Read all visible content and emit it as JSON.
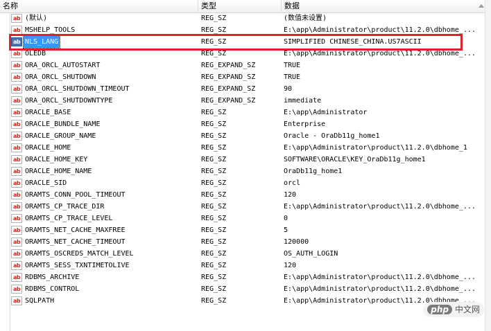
{
  "columns": {
    "name": "名称",
    "type": "类型",
    "data": "数据"
  },
  "value_icon": "ab",
  "rows": [
    {
      "name": "(默认)",
      "type": "REG_SZ",
      "data": "(数值未设置)"
    },
    {
      "name": "MSHELP_TOOLS",
      "type": "REG_SZ",
      "data": "E:\\app\\Administrator\\product\\11.2.0\\dbhome_..."
    },
    {
      "name": "NLS_LANG",
      "type": "REG_SZ",
      "data": "SIMPLIFIED CHINESE_CHINA.US7ASCII"
    },
    {
      "name": "OLEDB",
      "type": "REG_SZ",
      "data": "E:\\app\\Administrator\\product\\11.2.0\\dbhome_..."
    },
    {
      "name": "ORA_ORCL_AUTOSTART",
      "type": "REG_EXPAND_SZ",
      "data": "TRUE"
    },
    {
      "name": "ORA_ORCL_SHUTDOWN",
      "type": "REG_EXPAND_SZ",
      "data": "TRUE"
    },
    {
      "name": "ORA_ORCL_SHUTDOWN_TIMEOUT",
      "type": "REG_EXPAND_SZ",
      "data": "90"
    },
    {
      "name": "ORA_ORCL_SHUTDOWNTYPE",
      "type": "REG_EXPAND_SZ",
      "data": "immediate"
    },
    {
      "name": "ORACLE_BASE",
      "type": "REG_SZ",
      "data": "E:\\app\\Administrator"
    },
    {
      "name": "ORACLE_BUNDLE_NAME",
      "type": "REG_SZ",
      "data": "Enterprise"
    },
    {
      "name": "ORACLE_GROUP_NAME",
      "type": "REG_SZ",
      "data": "Oracle - OraDb11g_home1"
    },
    {
      "name": "ORACLE_HOME",
      "type": "REG_SZ",
      "data": "E:\\app\\Administrator\\product\\11.2.0\\dbhome_1"
    },
    {
      "name": "ORACLE_HOME_KEY",
      "type": "REG_SZ",
      "data": "SOFTWARE\\ORACLE\\KEY_OraDb11g_home1"
    },
    {
      "name": "ORACLE_HOME_NAME",
      "type": "REG_SZ",
      "data": "OraDb11g_home1"
    },
    {
      "name": "ORACLE_SID",
      "type": "REG_SZ",
      "data": "orcl"
    },
    {
      "name": "ORAMTS_CONN_POOL_TIMEOUT",
      "type": "REG_SZ",
      "data": "120"
    },
    {
      "name": "ORAMTS_CP_TRACE_DIR",
      "type": "REG_SZ",
      "data": "E:\\app\\Administrator\\product\\11.2.0\\dbhome_..."
    },
    {
      "name": "ORAMTS_CP_TRACE_LEVEL",
      "type": "REG_SZ",
      "data": "0"
    },
    {
      "name": "ORAMTS_NET_CACHE_MAXFREE",
      "type": "REG_SZ",
      "data": "5"
    },
    {
      "name": "ORAMTS_NET_CACHE_TIMEOUT",
      "type": "REG_SZ",
      "data": "120000"
    },
    {
      "name": "ORAMTS_OSCREDS_MATCH_LEVEL",
      "type": "REG_SZ",
      "data": "OS_AUTH_LOGIN"
    },
    {
      "name": "ORAMTS_SESS_TXNTIMETOLIVE",
      "type": "REG_SZ",
      "data": "120"
    },
    {
      "name": "RDBMS_ARCHIVE",
      "type": "REG_SZ",
      "data": "E:\\app\\Administrator\\product\\11.2.0\\dbhome_..."
    },
    {
      "name": "RDBMS_CONTROL",
      "type": "REG_SZ",
      "data": "E:\\app\\Administrator\\product\\11.2.0\\dbhome_..."
    },
    {
      "name": "SQLPATH",
      "type": "REG_SZ",
      "data": "E:\\app\\Administrator\\product\\11.2.0\\dbhome_..."
    }
  ],
  "watermark": {
    "badge": "php",
    "text": "中文网"
  },
  "colors": {
    "highlight": "#e0202a",
    "selection": "#3399ff",
    "icon": "#d0281c"
  }
}
